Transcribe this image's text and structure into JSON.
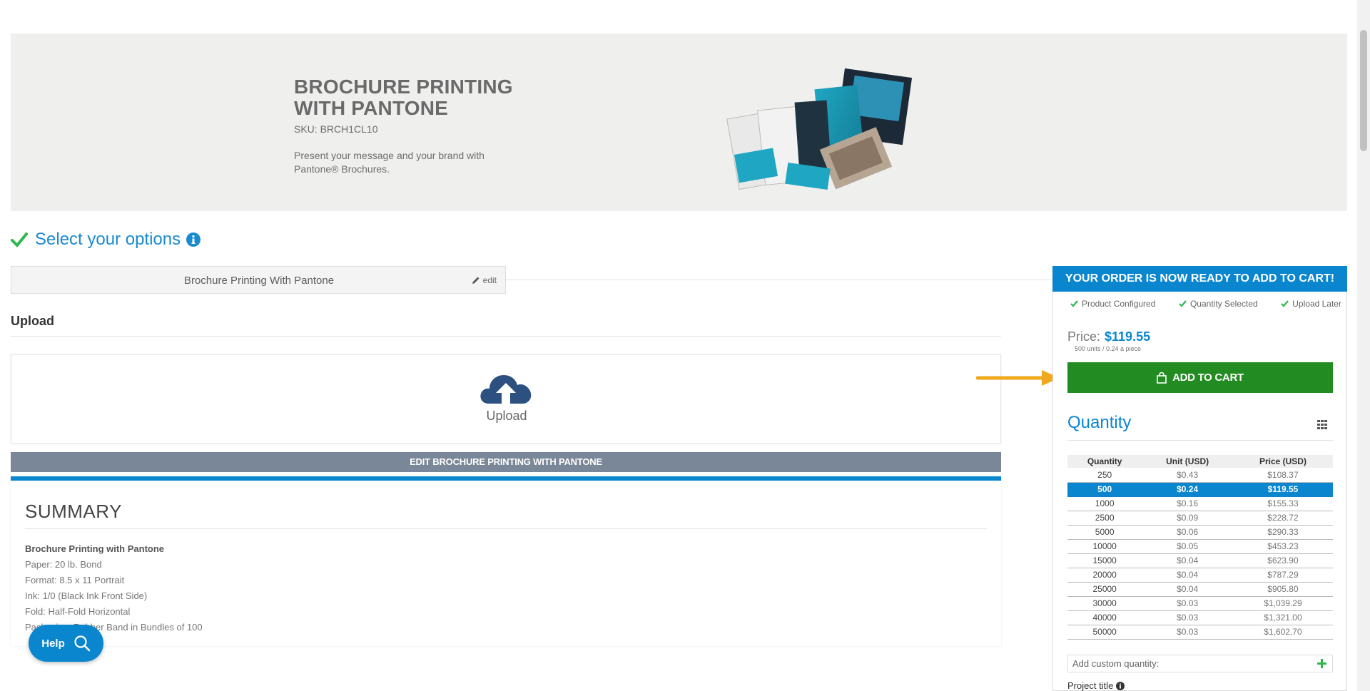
{
  "hero": {
    "title": "BROCHURE PRINTING WITH PANTONE",
    "sku": "SKU: BRCH1CL10",
    "description": "Present your message and your brand with Pantone® Brochures."
  },
  "options": {
    "title": "Select your options",
    "product_label": "Brochure Printing With Pantone",
    "edit_label": "edit"
  },
  "upload": {
    "heading": "Upload",
    "label": "Upload",
    "edit_bar_label": "EDIT BROCHURE PRINTING WITH PANTONE"
  },
  "summary": {
    "title": "SUMMARY",
    "product": "Brochure Printing with Pantone",
    "lines": [
      "Paper: 20 lb. Bond",
      "Format: 8.5 x 11 Portrait",
      "Ink: 1/0 (Black Ink Front Side)",
      "Fold: Half-Fold Horizontal",
      "Packaging: Rubber Band in Bundles of 100"
    ]
  },
  "help": {
    "label": "Help"
  },
  "order": {
    "banner": "YOUR ORDER IS NOW READY TO ADD TO CART!",
    "status": [
      "Product Configured",
      "Quantity Selected",
      "Upload Later"
    ],
    "price_label": "Price:",
    "price_value": "$119.55",
    "price_sub": "500 units / 0.24 a piece",
    "add_to_cart": "ADD TO CART"
  },
  "quantity": {
    "title": "Quantity",
    "headers": [
      "Quantity",
      "Unit (USD)",
      "Price (USD)"
    ],
    "rows": [
      [
        "250",
        "$0.43",
        "$108.37"
      ],
      [
        "500",
        "$0.24",
        "$119.55"
      ],
      [
        "1000",
        "$0.16",
        "$155.33"
      ],
      [
        "2500",
        "$0.09",
        "$228.72"
      ],
      [
        "5000",
        "$0.06",
        "$290.33"
      ],
      [
        "10000",
        "$0.05",
        "$453.23"
      ],
      [
        "15000",
        "$0.04",
        "$623.90"
      ],
      [
        "20000",
        "$0.04",
        "$787.29"
      ],
      [
        "25000",
        "$0.04",
        "$905.80"
      ],
      [
        "30000",
        "$0.03",
        "$1,039.29"
      ],
      [
        "40000",
        "$0.03",
        "$1,321.00"
      ],
      [
        "50000",
        "$0.03",
        "$1,602.70"
      ]
    ],
    "selected_index": 1,
    "custom_placeholder": "Add custom quantity:",
    "project_title_label": "Project title"
  },
  "colors": {
    "accent_blue": "#0a86cf",
    "cart_green": "#228b22",
    "check_green": "#2db84d",
    "arrow_orange": "#f0a91c"
  }
}
